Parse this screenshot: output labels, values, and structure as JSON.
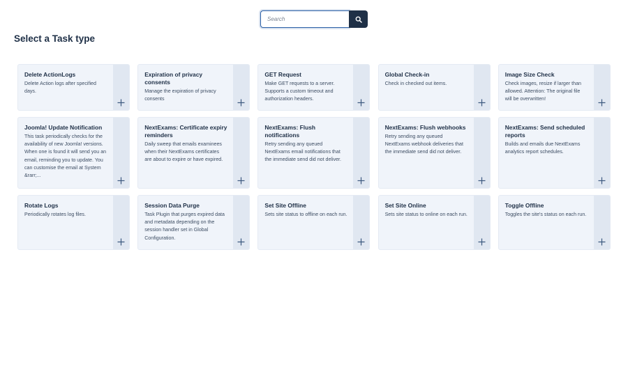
{
  "search": {
    "placeholder": "Search"
  },
  "page": {
    "title": "Select a Task type"
  },
  "tasks": [
    {
      "title": "Delete ActionLogs",
      "description": "Delete Action logs after specified days."
    },
    {
      "title": "Expiration of privacy consents",
      "description": "Manage the expiration of privacy consents"
    },
    {
      "title": "GET Request",
      "description": "Make GET requests to a server. Supports a custom timeout and authorization headers."
    },
    {
      "title": "Global Check-in",
      "description": "Check in checked out items."
    },
    {
      "title": "Image Size Check",
      "description": "Check images, resize if larger than allowed. Attention: The original file will be overwritten!"
    },
    {
      "title": "Joomla! Update Notification",
      "description": "This task periodically checks for the availability of new Joomla! versions. When one is found it will send you an email, reminding you to update. You can customise the email at System &rarr;..."
    },
    {
      "title": "NextExams: Certificate expiry reminders",
      "description": "Daily sweep that emails examinees when their NextExams certificates are about to expire or have expired."
    },
    {
      "title": "NextExams: Flush notifications",
      "description": "Retry sending any queued NextExams email notifications that the immediate send did not deliver."
    },
    {
      "title": "NextExams: Flush webhooks",
      "description": "Retry sending any queued NextExams webhook deliveries that the immediate send did not deliver."
    },
    {
      "title": "NextExams: Send scheduled reports",
      "description": "Builds and emails due NextExams analytics report schedules."
    },
    {
      "title": "Rotate Logs",
      "description": "Periodically rotates log files."
    },
    {
      "title": "Session Data Purge",
      "description": "Task Plugin that purges expired data and metadata depending on the session handler set in Global Configuration."
    },
    {
      "title": "Set Site Offline",
      "description": "Sets site status to offline on each run."
    },
    {
      "title": "Set Site Online",
      "description": "Sets site status to online on each run."
    },
    {
      "title": "Toggle Offline",
      "description": "Toggles the site's status on each run."
    }
  ],
  "icons": {
    "search": "search-icon",
    "add": "plus-icon"
  },
  "colors": {
    "primary": "#1f3047",
    "card_bg": "#f0f4fa",
    "card_side": "#e0e7f1",
    "focus_border": "#2a5fa6"
  }
}
